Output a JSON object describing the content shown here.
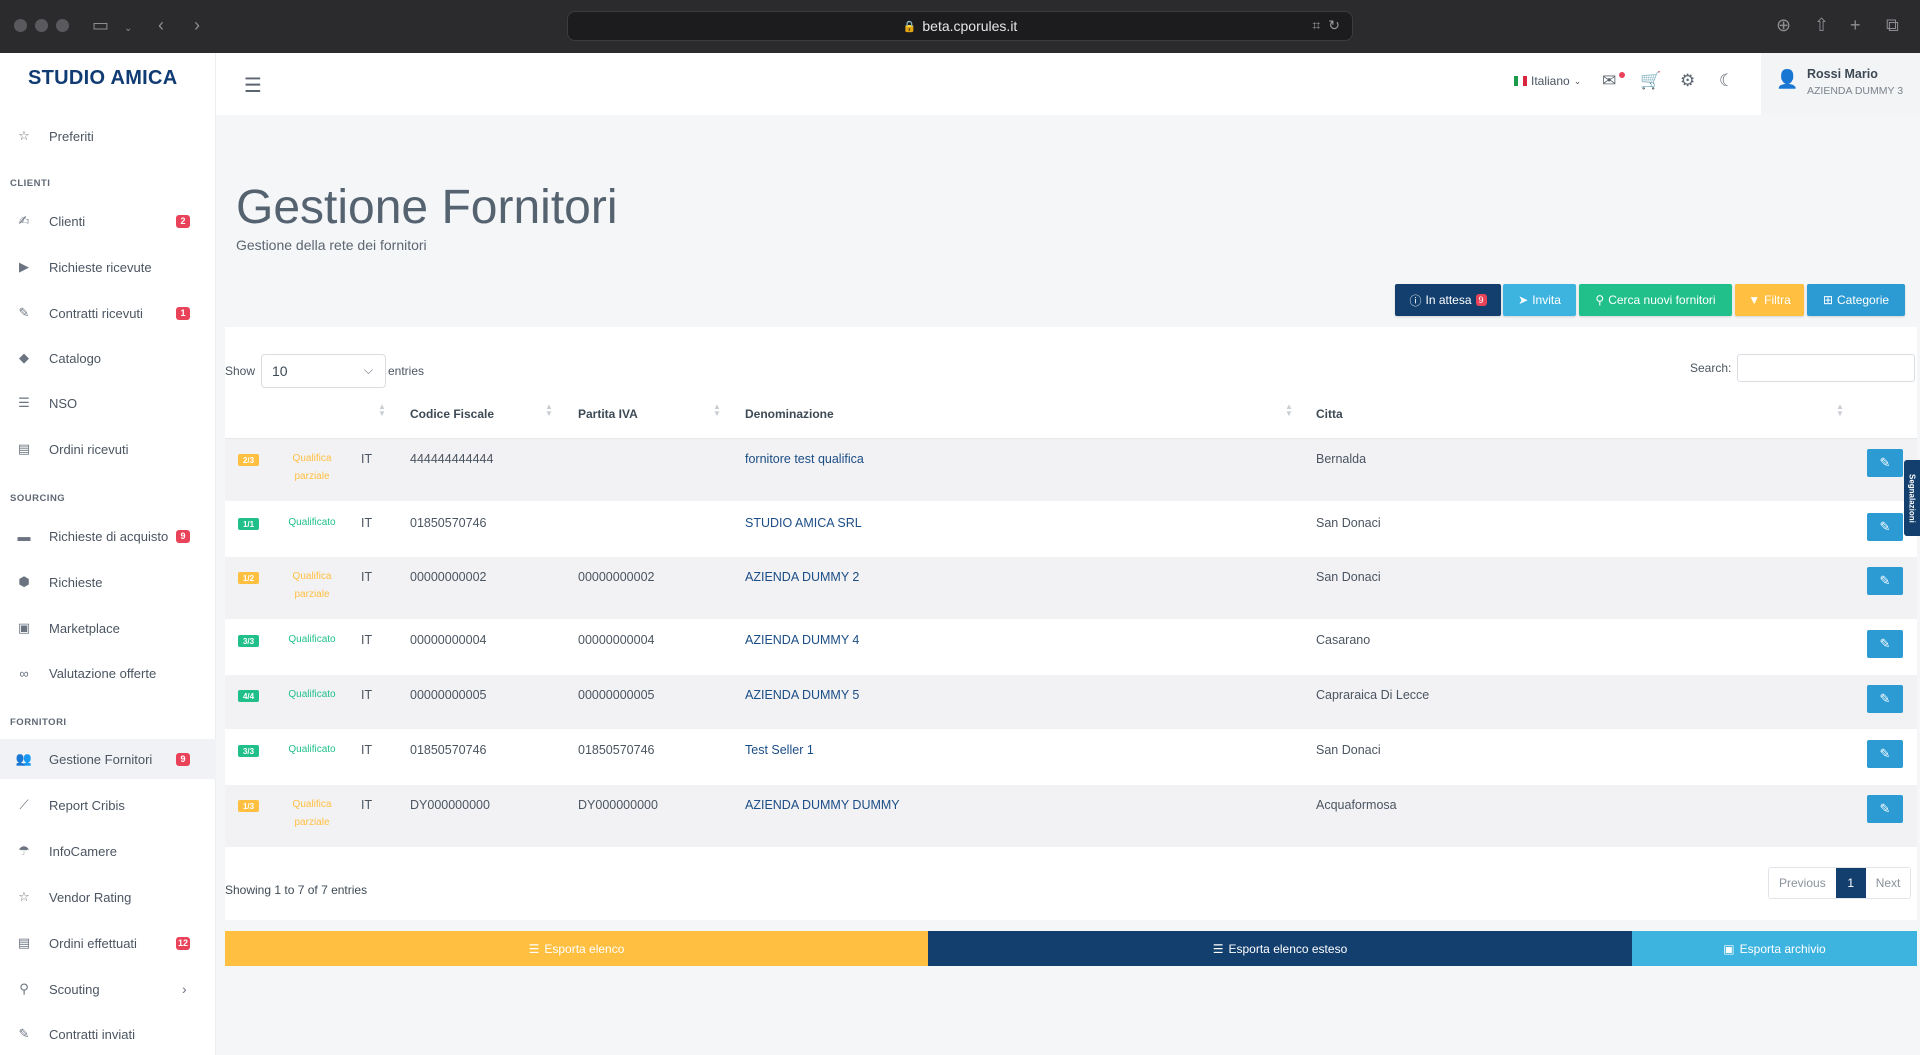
{
  "browser": {
    "url": "beta.cporules.it"
  },
  "brand": "STUDIO AMICA",
  "sidebar": {
    "items": [
      {
        "label": "Preferiti",
        "icon": "star-icon",
        "glyph": "☆",
        "badge": ""
      },
      {
        "label": "Clienti",
        "icon": "handshake-icon",
        "glyph": "✍",
        "badge": "2"
      },
      {
        "label": "Richieste ricevute",
        "icon": "play-circle-icon",
        "glyph": "▶",
        "badge": ""
      },
      {
        "label": "Contratti ricevuti",
        "icon": "file-signature-icon",
        "glyph": "✎",
        "badge": "1"
      },
      {
        "label": "Catalogo",
        "icon": "tags-icon",
        "glyph": "◆",
        "badge": ""
      },
      {
        "label": "NSO",
        "icon": "list-icon",
        "glyph": "☰",
        "badge": ""
      },
      {
        "label": "Ordini ricevuti",
        "icon": "receipt-icon",
        "glyph": "▤",
        "badge": ""
      },
      {
        "label": "Richieste di acquisto",
        "icon": "credit-card-icon",
        "glyph": "▬",
        "badge": "9"
      },
      {
        "label": "Richieste",
        "icon": "cube-icon",
        "glyph": "⬢",
        "badge": ""
      },
      {
        "label": "Marketplace",
        "icon": "shopping-bag-icon",
        "glyph": "▣",
        "badge": ""
      },
      {
        "label": "Valutazione offerte",
        "icon": "infinity-icon",
        "glyph": "∞",
        "badge": ""
      },
      {
        "label": "Gestione Fornitori",
        "icon": "users-icon",
        "glyph": "👥",
        "badge": "9"
      },
      {
        "label": "Report Cribis",
        "icon": "report-icon",
        "glyph": "⟋",
        "badge": ""
      },
      {
        "label": "InfoCamere",
        "icon": "umbrella-icon",
        "glyph": "☂",
        "badge": ""
      },
      {
        "label": "Vendor Rating",
        "icon": "star-icon",
        "glyph": "☆",
        "badge": ""
      },
      {
        "label": "Ordini effettuati",
        "icon": "receipt-icon",
        "glyph": "▤",
        "badge": "12"
      },
      {
        "label": "Scouting",
        "icon": "search-icon",
        "glyph": "⚲",
        "badge": "",
        "chevron": "›"
      },
      {
        "label": "Contratti inviati",
        "icon": "file-signature-icon",
        "glyph": "✎",
        "badge": ""
      }
    ],
    "sections": [
      "CLIENTI",
      "SOURCING",
      "FORNITORI"
    ]
  },
  "topbar": {
    "language": "Italiano",
    "user_name": "Rossi Mario",
    "user_company": "AZIENDA DUMMY 3"
  },
  "page": {
    "title": "Gestione Fornitori",
    "subtitle": "Gestione della rete dei fornitori"
  },
  "toolbar": {
    "in_attesa": "In attesa",
    "in_attesa_count": "9",
    "invita": "Invita",
    "cerca": "Cerca nuovi fornitori",
    "filtra": "Filtra",
    "categorie": "Categorie"
  },
  "colors": {
    "navy": "#123f6e",
    "light_blue": "#3db4e0",
    "green": "#21c08b",
    "orange": "#ffbf40",
    "badge_red": "#e9435a"
  },
  "table": {
    "show_label": "Show",
    "page_size": "10",
    "entries_label": "entries",
    "search_label": "Search:",
    "columns": [
      "Codice Fiscale",
      "Partita IVA",
      "Denominazione",
      "Citta"
    ],
    "rows": [
      {
        "tag": "2/3",
        "status": "Qualifica parziale",
        "qualified": false,
        "country": "IT",
        "cf": "444444444444",
        "piva": "",
        "name": "fornitore test qualifica",
        "city": "Bernalda"
      },
      {
        "tag": "1/1",
        "status": "Qualificato",
        "qualified": true,
        "country": "IT",
        "cf": "01850570746",
        "piva": "",
        "name": "STUDIO AMICA SRL",
        "city": "San Donaci"
      },
      {
        "tag": "1/2",
        "status": "Qualifica parziale",
        "qualified": false,
        "country": "IT",
        "cf": "00000000002",
        "piva": "00000000002",
        "name": "AZIENDA DUMMY 2",
        "city": "San Donaci"
      },
      {
        "tag": "3/3",
        "status": "Qualificato",
        "qualified": true,
        "country": "IT",
        "cf": "00000000004",
        "piva": "00000000004",
        "name": "AZIENDA DUMMY 4",
        "city": "Casarano"
      },
      {
        "tag": "4/4",
        "status": "Qualificato",
        "qualified": true,
        "country": "IT",
        "cf": "00000000005",
        "piva": "00000000005",
        "name": "AZIENDA DUMMY 5",
        "city": "Capraraica Di Lecce"
      },
      {
        "tag": "3/3",
        "status": "Qualificato",
        "qualified": true,
        "country": "IT",
        "cf": "01850570746",
        "piva": "01850570746",
        "name": "Test Seller 1",
        "city": "San Donaci"
      },
      {
        "tag": "1/3",
        "status": "Qualifica parziale",
        "qualified": false,
        "country": "IT",
        "cf": "DY000000000",
        "piva": "DY000000000",
        "name": "AZIENDA DUMMY DUMMY",
        "city": "Acquaformosa"
      }
    ],
    "showing": "Showing 1 to 7 of 7 entries",
    "pager": {
      "prev": "Previous",
      "current": "1",
      "next": "Next"
    }
  },
  "export": {
    "elenco": "Esporta elenco",
    "esteso": "Esporta elenco esteso",
    "archivio": "Esporta archivio"
  },
  "side_tab": "Segnalazioni"
}
